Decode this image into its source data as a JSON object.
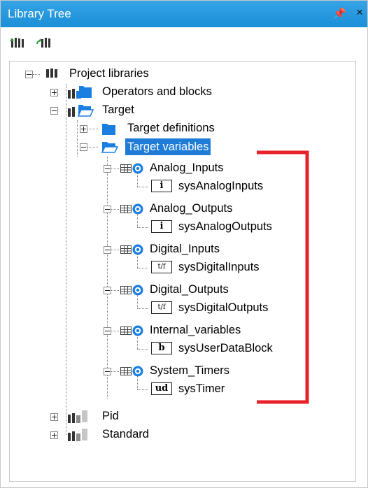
{
  "panel": {
    "title": "Library Tree",
    "pin_glyph": "📌",
    "close_glyph": "×"
  },
  "toolbar": {
    "buttons": [
      {
        "icon": "refresh-libraries-icon"
      },
      {
        "icon": "reload-libraries-icon"
      }
    ]
  },
  "tree": {
    "root": "Project libraries",
    "operators": "Operators and blocks",
    "target": "Target",
    "target_definitions": "Target definitions",
    "target_variables": "Target variables",
    "groups": [
      {
        "name": "Analog_Inputs",
        "child": "sysAnalogInputs",
        "type_badge": "i"
      },
      {
        "name": "Analog_Outputs",
        "child": "sysAnalogOutputs",
        "type_badge": "i"
      },
      {
        "name": "Digital_Inputs",
        "child": "sysDigitalInputs",
        "type_badge": "t/f"
      },
      {
        "name": "Digital_Outputs",
        "child": "sysDigitalOutputs",
        "type_badge": "t/f"
      },
      {
        "name": "Internal_variables",
        "child": "sysUserDataBlock",
        "type_badge": "b"
      },
      {
        "name": "System_Timers",
        "child": "sysTimer",
        "type_badge": "ud"
      }
    ],
    "pid": "Pid",
    "standard": "Standard"
  },
  "colors": {
    "titlebar": "#1b8fd8",
    "selection": "#1e7bd6",
    "annotation": "#e8202a",
    "folder_blue": "#1a7fe0"
  }
}
